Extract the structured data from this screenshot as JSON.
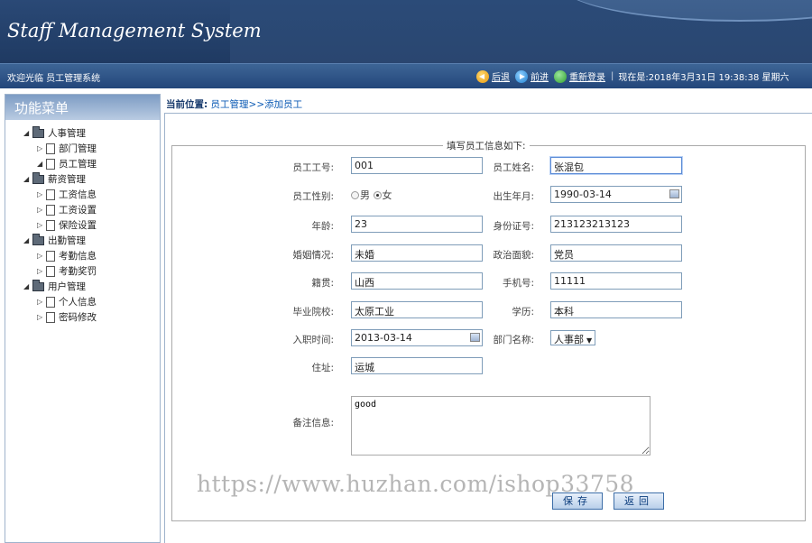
{
  "app": {
    "title": "Staff Management System"
  },
  "status": {
    "welcome": "欢迎光临 员工管理系统",
    "back_label": "后退",
    "forward_label": "前进",
    "relogin_label": "重新登录",
    "separator": "|",
    "now_text": "现在是:2018年3月31日 19:38:38 星期六"
  },
  "sidebar": {
    "title": "功能菜单",
    "groups": [
      {
        "label": "人事管理",
        "items": [
          "部门管理",
          "员工管理"
        ]
      },
      {
        "label": "薪资管理",
        "items": [
          "工资信息",
          "工资设置",
          "保险设置"
        ]
      },
      {
        "label": "出勤管理",
        "items": [
          "考勤信息",
          "考勤奖罚"
        ]
      },
      {
        "label": "用户管理",
        "items": [
          "个人信息",
          "密码修改"
        ]
      }
    ]
  },
  "breadcrumb": {
    "prefix": "当前位置:",
    "path": "员工管理>>添加员工"
  },
  "form": {
    "legend": "填写员工信息如下:",
    "emp_no": {
      "label": "员工工号:",
      "value": "001"
    },
    "emp_name": {
      "label": "员工姓名:",
      "value": "张混包"
    },
    "gender": {
      "label": "员工性别:",
      "opt_male": "男",
      "opt_female": "女",
      "selected": "女"
    },
    "birth": {
      "label": "出生年月:",
      "value": "1990-03-14"
    },
    "age": {
      "label": "年龄:",
      "value": "23"
    },
    "id_no": {
      "label": "身份证号:",
      "value": "213123213123"
    },
    "marital": {
      "label": "婚姻情况:",
      "value": "未婚"
    },
    "political": {
      "label": "政治面貌:",
      "value": "党员"
    },
    "native": {
      "label": "籍贯:",
      "value": "山西"
    },
    "phone": {
      "label": "手机号:",
      "value": "11111"
    },
    "school": {
      "label": "毕业院校:",
      "value": "太原工业"
    },
    "education": {
      "label": "学历:",
      "value": "本科"
    },
    "hire_date": {
      "label": "入职时间:",
      "value": "2013-03-14"
    },
    "dept": {
      "label": "部门名称:",
      "value": "人事部"
    },
    "address": {
      "label": "住址:",
      "value": "运城"
    },
    "remark": {
      "label": "备注信息:",
      "value": "good"
    },
    "save_label": "保存",
    "return_label": "返回"
  },
  "watermark": "https://www.huzhan.com/ishop33758"
}
